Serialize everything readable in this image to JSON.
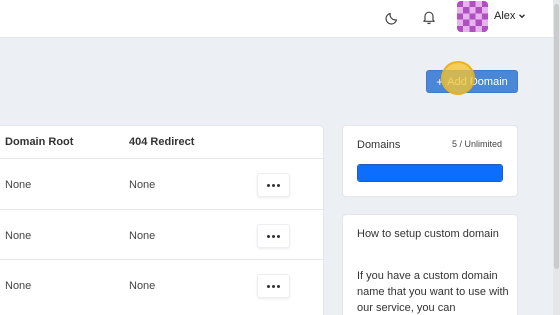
{
  "header": {
    "user_name": "Alex",
    "icons": [
      "moon-icon",
      "bell-icon",
      "chevron-down-icon"
    ],
    "avatar_colors": [
      "#b04fc0",
      "#e6b3ec"
    ]
  },
  "toolbar": {
    "add_domain_label": "Add Domain",
    "add_domain_icon": "plus-icon",
    "accent": "#4a87d9"
  },
  "table": {
    "columns": [
      "Domain Root",
      "404 Redirect"
    ],
    "rows": [
      {
        "domain_root": "None",
        "redirect": "None",
        "actions_icon": "more-icon"
      },
      {
        "domain_root": "None",
        "redirect": "None",
        "actions_icon": "more-icon"
      },
      {
        "domain_root": "None",
        "redirect": "None",
        "actions_icon": "more-icon"
      }
    ]
  },
  "domains_panel": {
    "title": "Domains",
    "usage": "5 / Unlimited",
    "progress_percent": 100,
    "progress_color": "#0d6efd"
  },
  "help_panel": {
    "title": "How to setup custom domain",
    "body": "If you have a custom domain name that you want to use with our service, you can"
  }
}
